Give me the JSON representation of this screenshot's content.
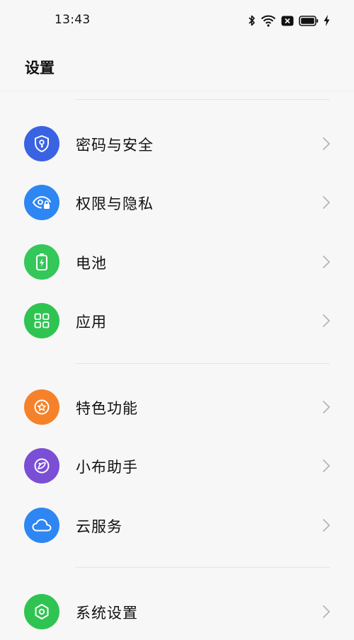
{
  "status_bar": {
    "time": "13:43",
    "icons": [
      "bluetooth-icon",
      "wifi-icon",
      "sim-off-icon",
      "battery-icon",
      "charging-icon"
    ]
  },
  "header": {
    "title": "设置"
  },
  "menu": {
    "groups": [
      {
        "items": [
          {
            "label": "密码与安全",
            "icon": "shield-key-icon",
            "color": "#3a63e3"
          },
          {
            "label": "权限与隐私",
            "icon": "eye-lock-icon",
            "color": "#2e86f2"
          },
          {
            "label": "电池",
            "icon": "battery-charge-icon",
            "color": "#34c759"
          },
          {
            "label": "应用",
            "icon": "app-grid-icon",
            "color": "#2fc451"
          }
        ]
      },
      {
        "items": [
          {
            "label": "特色功能",
            "icon": "star-badge-icon",
            "color": "#f5822a"
          },
          {
            "label": "小布助手",
            "icon": "assistant-icon",
            "color": "#7a4fd6"
          },
          {
            "label": "云服务",
            "icon": "cloud-icon",
            "color": "#2e86f2"
          }
        ]
      },
      {
        "items": [
          {
            "label": "系统设置",
            "icon": "gear-hex-icon",
            "color": "#2fc451"
          }
        ]
      }
    ]
  }
}
